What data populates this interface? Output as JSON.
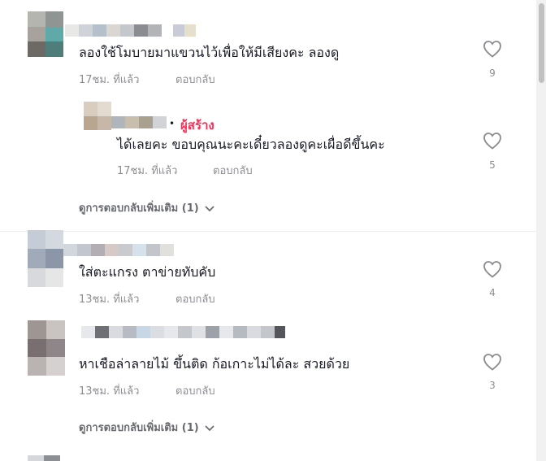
{
  "comments": [
    {
      "text": "ลองใช้โมบายมาแขวนไว้เพื่อให้มีเสียงคะ ลองดู",
      "time": "17ชม. ที่แล้ว",
      "reply": "ตอบกลับ",
      "likes": "9"
    },
    {
      "creator_badge": "ผู้สร้าง",
      "text": "ได้เลยคะ ขอบคุณนะคะเดี๋ยวลองดูคะเผื่อดีขึ้นคะ",
      "time": "17ชม. ที่แล้ว",
      "reply": "ตอบกลับ",
      "likes": "5"
    },
    {
      "text": "ใส่ตะแกรง ตาข่ายทับคับ",
      "time": "13ชม. ที่แล้ว",
      "reply": "ตอบกลับ",
      "likes": "4"
    },
    {
      "text": "หาเชือล่าลายไม้ ขึ้นติด ก้อเกาะไม่ได้ละ สวยด้วย",
      "time": "13ชม. ที่แล้ว",
      "reply": "ตอบกลับ",
      "likes": "3"
    }
  ],
  "more_replies": [
    "ดูการตอบกลับเพิ่มเติม (1)",
    "ดูการตอบกลับเพิ่มเติม (1)"
  ],
  "colors": {
    "creator": "#fe2c55",
    "text": "#161823",
    "muted": "rgba(22,24,35,0.5)"
  },
  "icons": {
    "like": "heart-outline-icon",
    "expand": "chevron-down-icon"
  }
}
